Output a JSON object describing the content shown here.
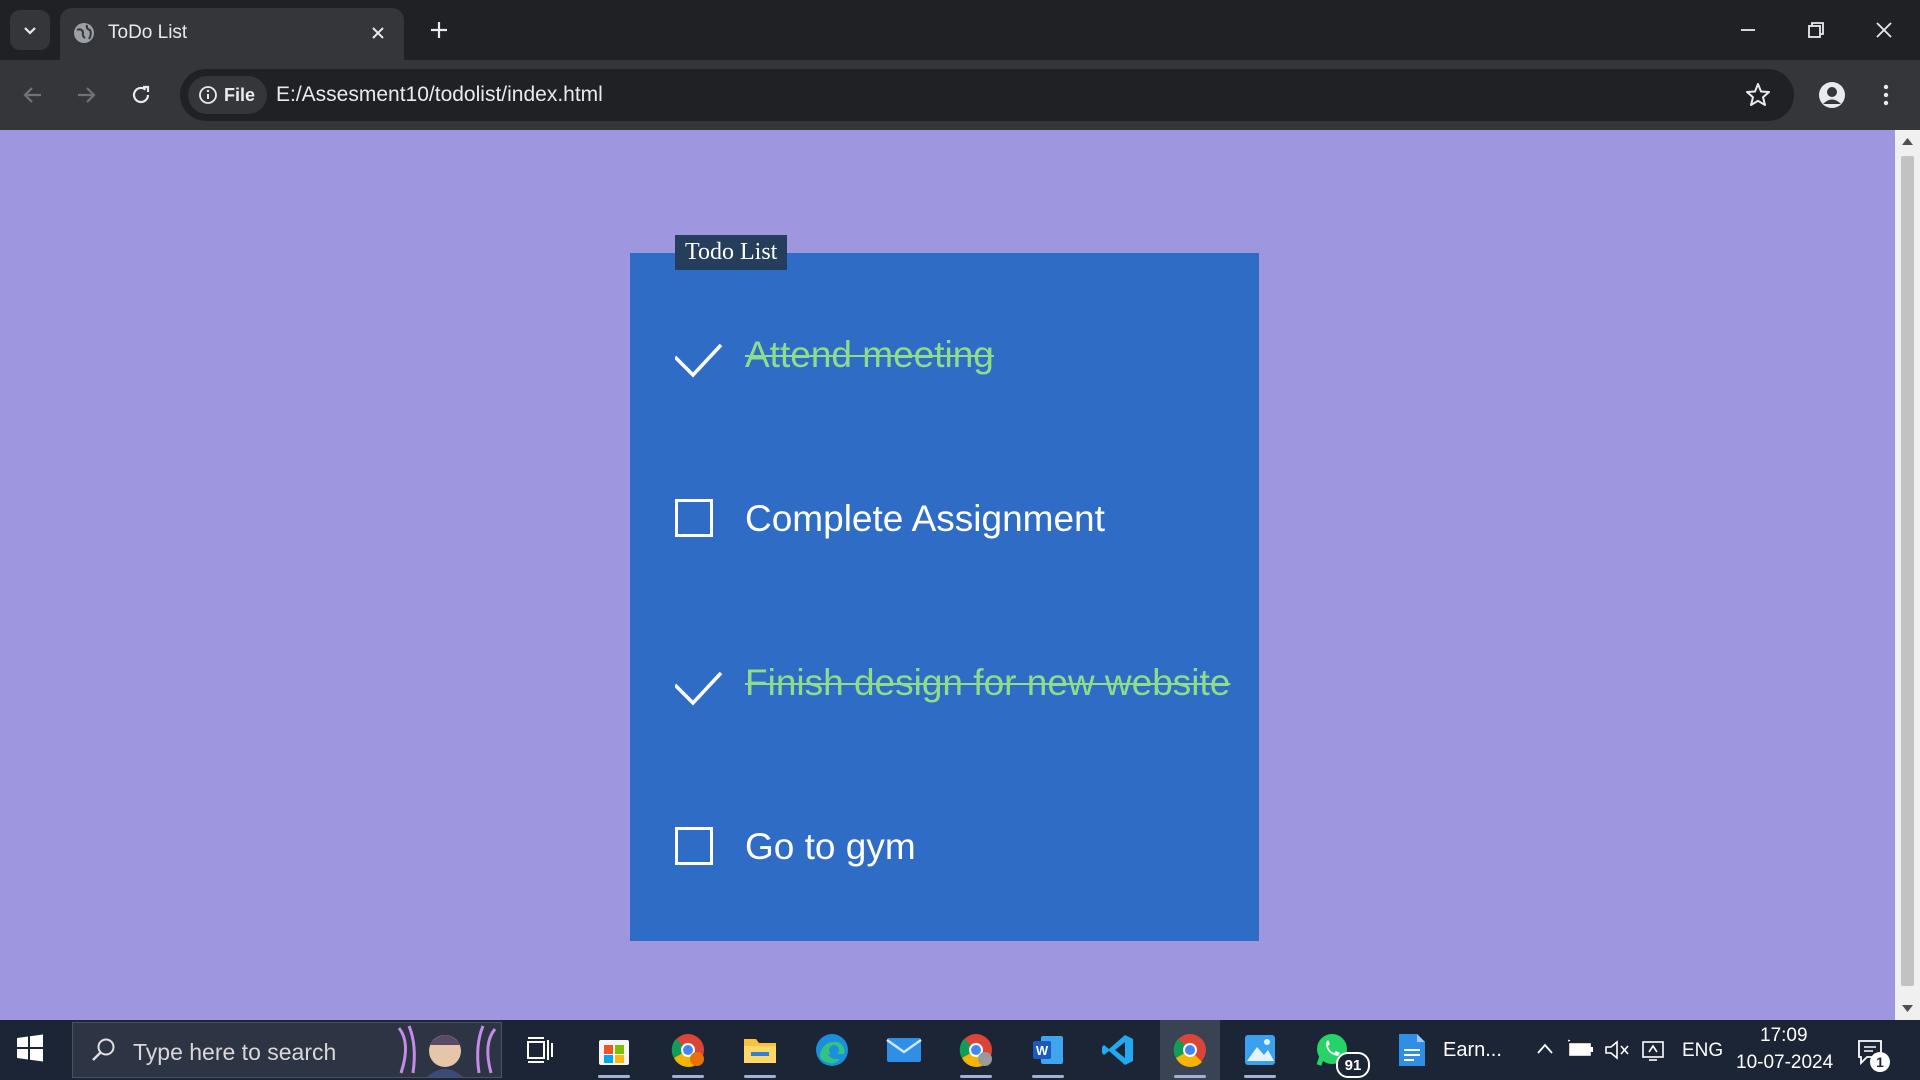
{
  "browser": {
    "tab_title": "ToDo List",
    "chip_label": "File",
    "url": "E:/Assesment10/todolist/index.html"
  },
  "page": {
    "legend": "Todo List",
    "items": [
      {
        "text": "Attend meeting",
        "done": true
      },
      {
        "text": "Complete Assignment",
        "done": false
      },
      {
        "text": "Finish design for new website",
        "done": true
      },
      {
        "text": "Go to gym",
        "done": false
      }
    ]
  },
  "taskbar": {
    "search_placeholder": "Type here to search",
    "app_label": "Earn...",
    "whatsapp_badge": "91",
    "language": "ENG",
    "time": "17:09",
    "date": "10-07-2024",
    "notification_count": "1"
  },
  "colors": {
    "page_bg": "#9e96df",
    "card_bg": "#2f6cc5",
    "done_text": "#8fdc8b",
    "legend_bg": "#243e5c"
  }
}
